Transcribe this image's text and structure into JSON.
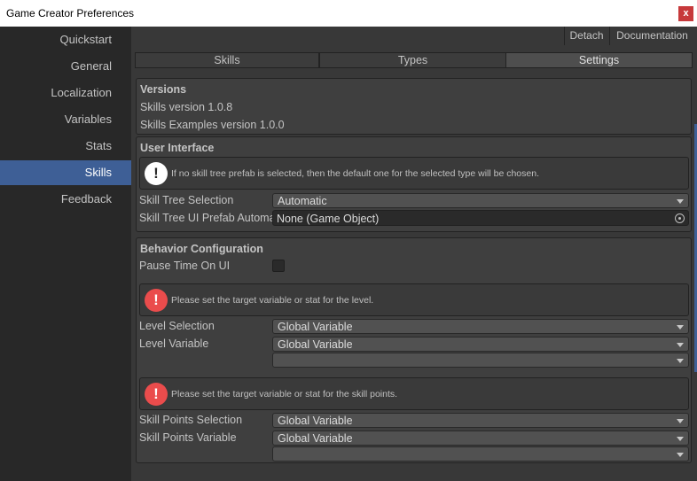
{
  "window": {
    "title": "Game Creator Preferences",
    "close_glyph": "x"
  },
  "sidebar": {
    "items": [
      {
        "label": "Quickstart"
      },
      {
        "label": "General"
      },
      {
        "label": "Localization"
      },
      {
        "label": "Variables"
      },
      {
        "label": "Stats"
      },
      {
        "label": "Skills",
        "active": true
      },
      {
        "label": "Feedback"
      }
    ]
  },
  "toolbar": {
    "detach_label": "Detach",
    "documentation_label": "Documentation"
  },
  "tabs": [
    {
      "label": "Skills"
    },
    {
      "label": "Types"
    },
    {
      "label": "Settings",
      "active": true
    }
  ],
  "versions": {
    "heading": "Versions",
    "skills_version": "Skills version 1.0.8",
    "examples_version": "Skills Examples version 1.0.0"
  },
  "user_interface": {
    "heading": "User Interface",
    "info_message": "If no skill tree prefab is selected, then the default one for the selected type will be chosen.",
    "skill_tree_selection_label": "Skill Tree Selection",
    "skill_tree_selection_value": "Automatic",
    "prefab_label": "Skill Tree UI Prefab Automatic",
    "prefab_value": "None (Game Object)"
  },
  "behavior": {
    "heading": "Behavior Configuration",
    "pause_label": "Pause Time On UI",
    "level_error": "Please set the target variable or stat for the level.",
    "level_selection_label": "Level Selection",
    "level_selection_value": "Global Variable",
    "level_variable_label": "Level Variable",
    "level_variable_value": "Global Variable",
    "level_variable_sub_value": "",
    "skillpoints_error": "Please set the target variable or stat for the skill points.",
    "skillpoints_selection_label": "Skill Points Selection",
    "skillpoints_selection_value": "Global Variable",
    "skillpoints_variable_label": "Skill Points Variable",
    "skillpoints_variable_value": "Global Variable",
    "skillpoints_variable_sub_value": ""
  },
  "icons": {
    "info": "info-icon",
    "error": "error-icon"
  },
  "colors": {
    "accent": "#3e5f96",
    "error": "#ea4c4c",
    "close": "#c7393b"
  }
}
